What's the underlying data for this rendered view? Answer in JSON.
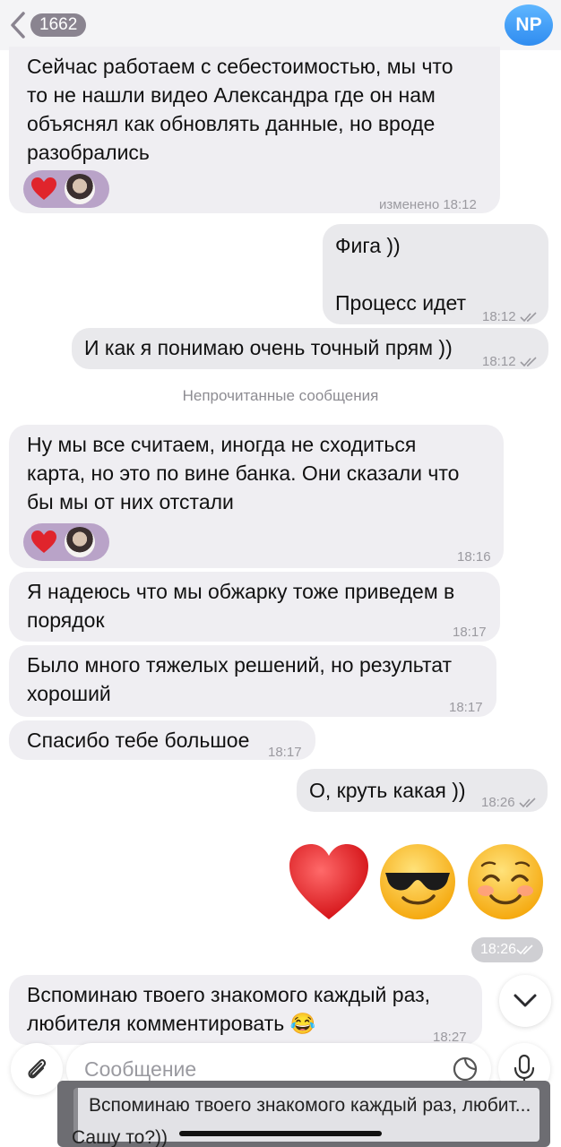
{
  "header": {
    "back_count": "1662",
    "avatar_initials": "NP"
  },
  "messages": [
    {
      "text_lines": [
        "Сейчас работаем с себестоимостью, мы что",
        "то не нашли видео Александра где он нам",
        "объяснял как обновлять данные, но вроде",
        "разобрались"
      ],
      "time": "изменено 18:12",
      "reaction": "heart"
    },
    {
      "text_lines": [
        "Фига ))",
        "",
        "Процесс идет"
      ],
      "time": "18:12"
    },
    {
      "text_lines": [
        "И как я понимаю очень точный прям ))"
      ],
      "time": "18:12"
    },
    {
      "text_lines": [
        "Ну мы все считаем, иногда не сходиться",
        "карта, но это по вине банка. Они сказали что",
        "бы мы от них отстали"
      ],
      "time": "18:16",
      "reaction": "heart"
    },
    {
      "text_lines": [
        "Я надеюсь что мы обжарку тоже приведем в",
        "порядок"
      ],
      "time": "18:17"
    },
    {
      "text_lines": [
        "Было много тяжелых решений, но результат",
        "хороший"
      ],
      "time": "18:17"
    },
    {
      "text_lines": [
        "Спасибо тебе большое"
      ],
      "time": "18:17"
    },
    {
      "text_lines": [
        "О, круть какая ))"
      ],
      "time": "18:26"
    },
    {
      "text_lines": [
        "Вспоминаю твоего знакомого каждый раз,",
        "любителя комментировать 😂"
      ],
      "time": "18:27"
    }
  ],
  "unread_divider": "Непрочитанные сообщения",
  "emoji_message": {
    "emojis": [
      "❤️",
      "😎",
      "☺️"
    ],
    "time": "18:26"
  },
  "composer": {
    "placeholder": "Сообщение"
  },
  "reply_overlay": {
    "quote": "Вспоминаю твоего знакомого каждый раз, любит...",
    "text": "Сашу то?))"
  }
}
